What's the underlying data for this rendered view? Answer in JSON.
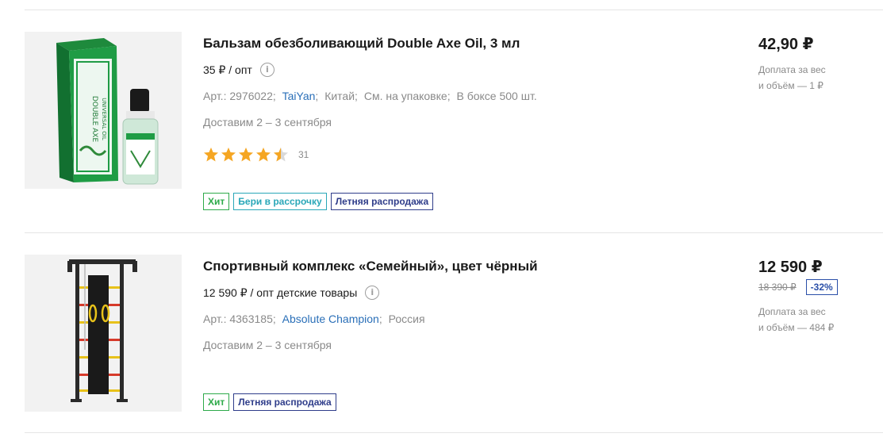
{
  "products": [
    {
      "title": "Бальзам обезболивающий Double Axe Oil, 3 мл",
      "opt_price": "35 ₽ / опт",
      "specs": {
        "article": "Арт.: 2976022;",
        "brand": "TaiYan",
        "country": "Китай;",
        "composition": "См. на упаковке;",
        "box": "В боксе 500 шт."
      },
      "delivery": "Доставим 2 – 3 сентября",
      "rating": {
        "value": 4.5,
        "max": 5,
        "count": "31"
      },
      "badges": {
        "hit": "Хит",
        "installment": "Бери в рассрочку",
        "sale": "Летняя распродажа"
      },
      "price": "42,90 ₽",
      "surcharge_line1": "Доплата за вес",
      "surcharge_line2": "и объём — 1 ₽"
    },
    {
      "title": "Спортивный комплекс «Семейный», цвет чёрный",
      "opt_price": "12 590 ₽ / опт детские товары",
      "specs": {
        "article": "Арт.: 4363185;",
        "brand": "Absolute Champion",
        "country": "Россия"
      },
      "delivery": "Доставим 2 – 3 сентября",
      "badges": {
        "hit": "Хит",
        "sale": "Летняя распродажа"
      },
      "price": "12 590 ₽",
      "old_price": "18 390 ₽",
      "discount": "-32%",
      "surcharge_line1": "Доплата за вес",
      "surcharge_line2": "и объём — 484 ₽"
    }
  ],
  "icons": {
    "info": "info-icon",
    "star": "star-icon"
  },
  "colors": {
    "star": "#f5a623",
    "brand_link": "#2a6fb8",
    "hit": "#2eaa4a",
    "installment": "#2aa7b8",
    "sale": "#2f3d8a",
    "discount": "#2a4fa8"
  }
}
